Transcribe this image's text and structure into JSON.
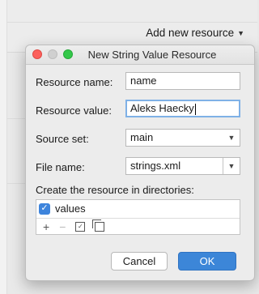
{
  "background": {
    "add_new_resource": "Add new resource"
  },
  "dialog": {
    "title": "New String Value Resource",
    "resource_name_label": "Resource name:",
    "resource_name_value": "name",
    "resource_value_label": "Resource value:",
    "resource_value_value": "Aleks Haecky",
    "source_set_label": "Source set:",
    "source_set_value": "main",
    "file_name_label": "File name:",
    "file_name_value": "strings.xml",
    "directories_label": "Create the resource in directories:",
    "directories": [
      {
        "name": "values",
        "checked": true
      }
    ],
    "cancel_label": "Cancel",
    "ok_label": "OK"
  },
  "colors": {
    "ok_button": "#3c86d8",
    "checkbox": "#3d84dc",
    "focus_ring": "#7fb1e6"
  }
}
